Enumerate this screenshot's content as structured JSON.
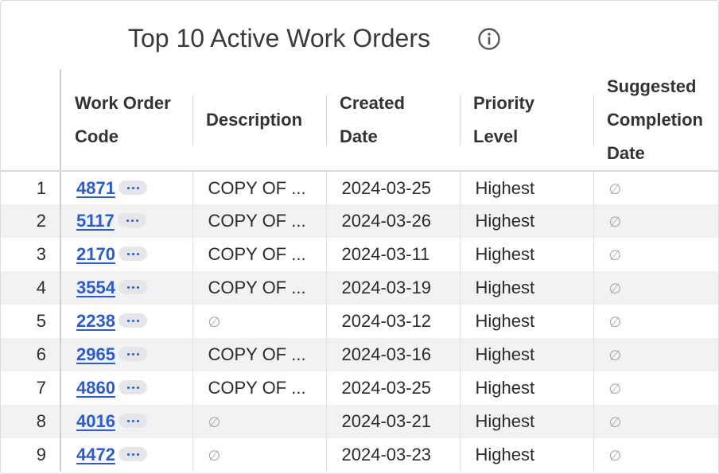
{
  "widget": {
    "title": "Top 10 Active Work Orders",
    "info_icon": "info-icon"
  },
  "table": {
    "headers": {
      "code": [
        "Work Order",
        "Code"
      ],
      "description": [
        "Description"
      ],
      "created": [
        "Created",
        "Date"
      ],
      "priority": [
        "Priority",
        "Level"
      ],
      "suggested": [
        "Suggested",
        "Completion",
        "Date"
      ]
    },
    "null_symbol": "∅",
    "rows": [
      {
        "index": "1",
        "code": "4871",
        "description": "COPY OF ...",
        "created": "2024-03-25",
        "priority": "Highest",
        "suggested": "∅"
      },
      {
        "index": "2",
        "code": "5117",
        "description": "COPY OF ...",
        "created": "2024-03-26",
        "priority": "Highest",
        "suggested": "∅"
      },
      {
        "index": "3",
        "code": "2170",
        "description": "COPY OF ...",
        "created": "2024-03-11",
        "priority": "Highest",
        "suggested": "∅"
      },
      {
        "index": "4",
        "code": "3554",
        "description": "COPY OF ...",
        "created": "2024-03-19",
        "priority": "Highest",
        "suggested": "∅"
      },
      {
        "index": "5",
        "code": "2238",
        "description": "∅",
        "created": "2024-03-12",
        "priority": "Highest",
        "suggested": "∅"
      },
      {
        "index": "6",
        "code": "2965",
        "description": "COPY OF ...",
        "created": "2024-03-16",
        "priority": "Highest",
        "suggested": "∅"
      },
      {
        "index": "7",
        "code": "4860",
        "description": "COPY OF ...",
        "created": "2024-03-25",
        "priority": "Highest",
        "suggested": "∅"
      },
      {
        "index": "8",
        "code": "4016",
        "description": "∅",
        "created": "2024-03-21",
        "priority": "Highest",
        "suggested": "∅"
      },
      {
        "index": "9",
        "code": "4472",
        "description": "∅",
        "created": "2024-03-23",
        "priority": "Highest",
        "suggested": "∅"
      }
    ]
  },
  "colors": {
    "link": "#2a5bd7",
    "row_alt": "#f1f2f2",
    "null": "#a8a8a8"
  }
}
